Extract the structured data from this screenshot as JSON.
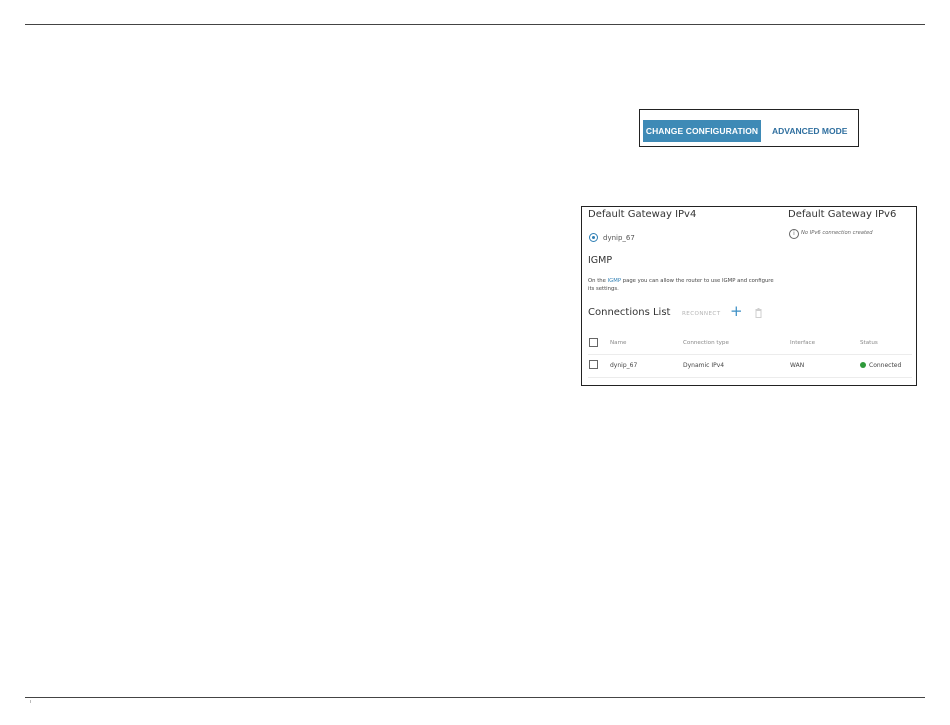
{
  "toolbar": {
    "change_config_label": "CHANGE CONFIGURATION",
    "advanced_mode_label": "ADVANCED MODE"
  },
  "gateway": {
    "ipv4_title": "Default Gateway IPv4",
    "ipv6_title": "Default Gateway IPv6",
    "ipv4_selected": "dynip_67",
    "ipv6_note": "No IPv6 connection created"
  },
  "igmp": {
    "title": "IGMP",
    "desc_before": "On the ",
    "link_text": "IGMP",
    "desc_after": " page you can allow the router to use IGMP and configure its settings."
  },
  "connections": {
    "title": "Connections List",
    "reconnect_label": "RECONNECT",
    "add_icon": "plus-icon",
    "delete_icon": "trash-icon",
    "columns": [
      "Name",
      "Connection type",
      "Interface",
      "Status"
    ],
    "rows": [
      {
        "name": "dynip_67",
        "type": "Dynamic IPv4",
        "interface": "WAN",
        "status": "Connected"
      }
    ],
    "status_color": "#2e9a3a"
  },
  "colors": {
    "accent": "#3e8ab6",
    "link": "#2f7fb4"
  }
}
